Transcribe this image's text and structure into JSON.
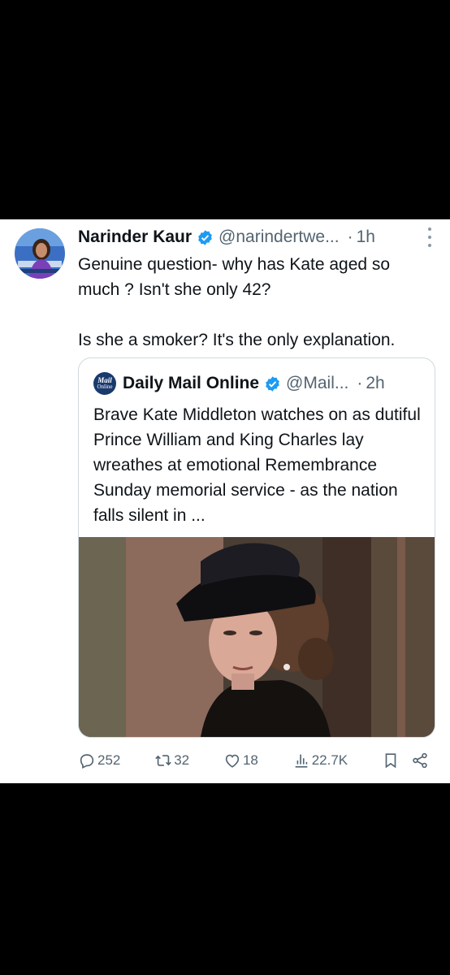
{
  "tweet": {
    "author_name": "Narinder Kaur",
    "author_handle": "@narindertwe...",
    "separator": "·",
    "time": "1h",
    "text_line1": "Genuine question- why has Kate aged so much ? Isn't she only 42?",
    "text_line2": "Is she a smoker? It's the only explanation."
  },
  "quote": {
    "logo_line1": "Mail",
    "logo_line2": "Online",
    "author_name": "Daily Mail Online",
    "author_handle": "@Mail...",
    "separator": "·",
    "time": "2h",
    "text": "Brave Kate Middleton watches on as dutiful Prince William and King Charles lay wreathes at emotional Remembrance Sunday memorial service - as the nation falls silent in ..."
  },
  "actions": {
    "replies": "252",
    "reposts": "32",
    "likes": "18",
    "views": "22.7K"
  },
  "colors": {
    "verified_blue": "#1d9bf0",
    "secondary_text": "#536471",
    "border": "#cfd9de"
  },
  "icons": [
    "more-vertical-icon",
    "verified-badge-icon",
    "reply-icon",
    "repost-icon",
    "like-icon",
    "views-icon",
    "bookmark-icon",
    "share-icon"
  ]
}
